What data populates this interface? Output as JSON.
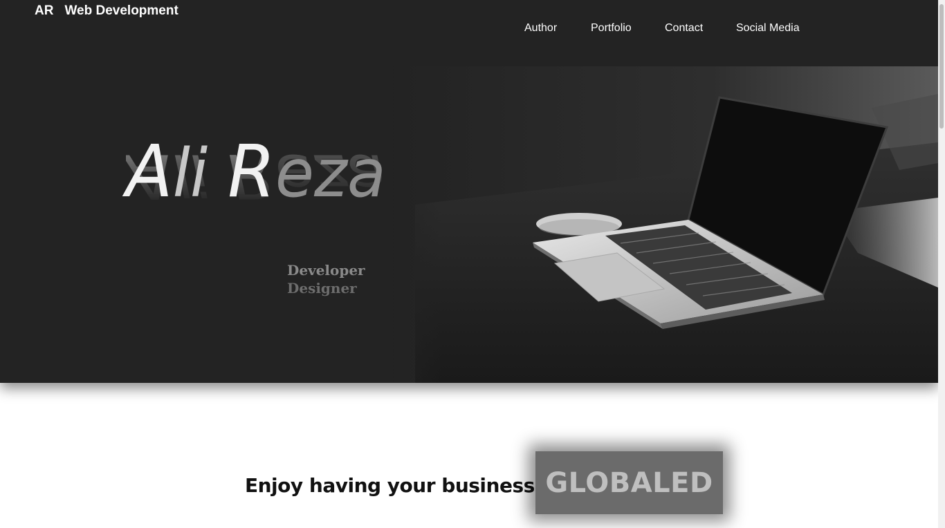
{
  "header": {
    "brand_mark": "AR",
    "brand_name": "Web Development"
  },
  "nav": {
    "items": [
      {
        "label": "Author"
      },
      {
        "label": "Portfolio"
      },
      {
        "label": "Contact"
      },
      {
        "label": "Social Media"
      }
    ]
  },
  "hero": {
    "name_first_cap": "A",
    "name_first_rest": "li",
    "name_last_cap": "R",
    "name_last_rest": "eza",
    "roles": [
      "Developer",
      "Designer"
    ],
    "image": "laptop-photo"
  },
  "promo": {
    "tagline": "Enjoy having your business",
    "highlight": "GLOBALED"
  },
  "colors": {
    "hero_bg": "#232323",
    "highlight_bg": "#6b6b6b",
    "highlight_text": "#bfbfbf"
  }
}
